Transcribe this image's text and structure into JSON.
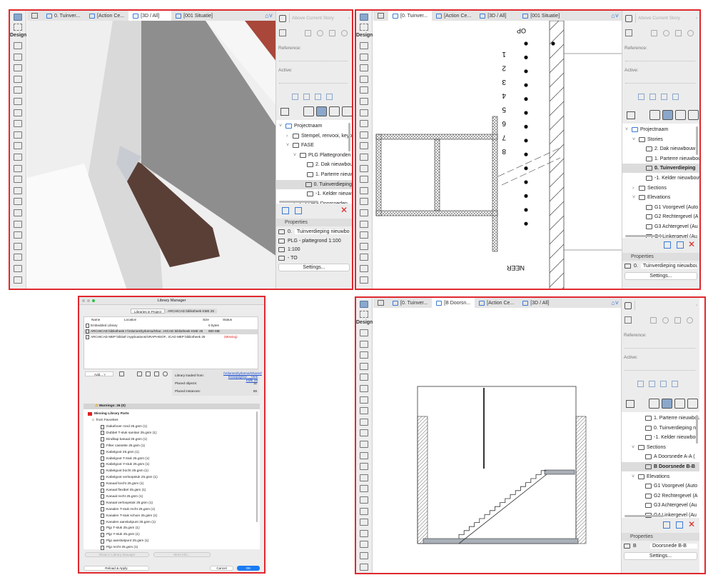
{
  "colors": {
    "accent": "#3a7bd5",
    "frame": "#e0282e",
    "missing": "#e02020",
    "ok_button": "#1a7cf5",
    "brick": "#a8473a",
    "stairs": "#5a3f36"
  },
  "toolbox": {
    "design_label": "Design"
  },
  "panel_3d": {
    "tabs": [
      {
        "label": "0. Tuinver...",
        "icon": "floor-plan-icon"
      },
      {
        "label": "[Action Ce...",
        "icon": "action-center-icon"
      },
      {
        "label": "[3D / All]",
        "icon": "3d-icon",
        "active": true
      },
      {
        "label": "[001 Situatie]",
        "icon": "layout-icon"
      }
    ],
    "story_label": "Above Current Story",
    "reference_label": "Reference:",
    "active_label": "Active:",
    "tree": [
      {
        "label": "Projectnaam",
        "level": 0,
        "arrow": "v"
      },
      {
        "label": "Stempel, renvooi, keyp",
        "level": 1,
        "arrow": ">"
      },
      {
        "label": "FASE",
        "level": 1,
        "arrow": "v"
      },
      {
        "label": "PLG Plattegronden",
        "level": 2,
        "arrow": "v"
      },
      {
        "label": "2. Dak nieuwbou",
        "level": 3
      },
      {
        "label": "1. Parterre nieuw",
        "level": 3
      },
      {
        "label": "0. Tuinverdieping",
        "level": 3,
        "selected": true
      },
      {
        "label": "-1. Kelder nieuwb",
        "level": 3
      },
      {
        "label": "DRS Doorsneden",
        "level": 2,
        "arrow": ">"
      }
    ],
    "properties_title": "Properties",
    "props": {
      "id": "0.",
      "name": "Tuinverdieping nieuwbouw",
      "view_set": "PLG - plattegrond 1:100",
      "scale": "1:100",
      "layer": "- TO"
    },
    "settings_label": "Settings..."
  },
  "panel_plan": {
    "tabs": [
      {
        "label": "[0. Tuinver...",
        "icon": "floor-plan-icon",
        "active": true
      },
      {
        "label": "[Action Ce...",
        "icon": "action-center-icon"
      },
      {
        "label": "[3D / All]",
        "icon": "3d-icon"
      },
      {
        "label": "[001 Situatie]",
        "icon": "layout-icon"
      }
    ],
    "story_label": "Above Current Story",
    "reference_label": "Reference:",
    "active_label": "Active:",
    "tree": [
      {
        "label": "Projectnaam",
        "level": 0,
        "arrow": "v"
      },
      {
        "label": "Stories",
        "level": 1,
        "arrow": "v"
      },
      {
        "label": "2. Dak nieuwbouw",
        "level": 2
      },
      {
        "label": "1. Parterre nieuwbouw",
        "level": 2
      },
      {
        "label": "0. Tuinverdieping",
        "level": 2,
        "selected": true,
        "bold": true
      },
      {
        "label": "-1. Kelder nieuwbouw",
        "level": 2
      },
      {
        "label": "Sections",
        "level": 1,
        "arrow": ">"
      },
      {
        "label": "Elevations",
        "level": 1,
        "arrow": "v"
      },
      {
        "label": "G1 Voorgevel (Auto",
        "level": 2
      },
      {
        "label": "G2 Rechtergevel (A",
        "level": 2
      },
      {
        "label": "G3 Achtergevel (Au",
        "level": 2
      },
      {
        "label": "G4 Linkergevel (Au",
        "level": 2
      }
    ],
    "properties_title": "Properties",
    "props": {
      "id": "0.",
      "name": "Tuinverdieping nieuwbouw"
    },
    "settings_label": "Settings...",
    "drawing": {
      "up_label": "OP",
      "down_label": "NEER",
      "step_numbers": [
        "1",
        "2",
        "3",
        "4",
        "5",
        "6",
        "7",
        "8"
      ]
    }
  },
  "panel_section": {
    "tabs": [
      {
        "label": "[0. Tuinver...",
        "icon": "floor-plan-icon"
      },
      {
        "label": "[B Doorsn...",
        "icon": "section-icon",
        "active": true
      },
      {
        "label": "[Action Ce...",
        "icon": "action-center-icon"
      },
      {
        "label": "[3D / All]",
        "icon": "3d-icon"
      }
    ],
    "reference_label": "Reference:",
    "active_label": "Active:",
    "tree": [
      {
        "label": "1. Parterre nieuwbouw",
        "level": 2
      },
      {
        "label": "0. Tuinverdieping n",
        "level": 2
      },
      {
        "label": "-1. Kelder nieuwbou",
        "level": 2
      },
      {
        "label": "Sections",
        "level": 1,
        "arrow": "v"
      },
      {
        "label": "A Doorsnede A-A (",
        "level": 2
      },
      {
        "label": "B Doorsnede B-B",
        "level": 2,
        "selected": true,
        "bold": true
      },
      {
        "label": "Elevations",
        "level": 1,
        "arrow": "v"
      },
      {
        "label": "G1 Voorgevel (Auto",
        "level": 2
      },
      {
        "label": "G2 Rechtergevel (A",
        "level": 2
      },
      {
        "label": "G3 Achtergevel (Au",
        "level": 2
      },
      {
        "label": "G4 Linkergevel (Au",
        "level": 2
      }
    ],
    "properties_title": "Properties",
    "props": {
      "id": "B",
      "name": "Doorsnede B-B"
    },
    "settings_label": "Settings..."
  },
  "library_manager": {
    "title": "Library Manager",
    "tabs": [
      "Libraries in Project",
      "ARCHICAD bibliotheek KME 25"
    ],
    "columns": [
      "Name",
      "Location",
      "Size",
      "Status"
    ],
    "rows": [
      {
        "name": "Embedded Library",
        "location": "",
        "size": "0 bytes",
        "status": ""
      },
      {
        "name": "ARCHICAD bibliotheek KM...",
        "location": "/Volumes/tyrkema/Shar...HICAD bibliotheek KME 25",
        "size": "980 MB",
        "status": "",
        "selected": true
      },
      {
        "name": "ARCHICAD MEP bibliothee...",
        "location": "/Applications/GRAPHISOF...ICAD MEP bibliotheek 25",
        "size": "",
        "status": "(Missing)"
      }
    ],
    "add_label": "Add...",
    "loaded_from_label": "Library loaded from:",
    "loaded_from_path": "/Volumes/tyrkema/Shared/ bouwpagina/..._teek KME 25",
    "placed_objects_label": "Placed objects:",
    "placed_objects": "11",
    "placed_instances_label": "Placed instances:",
    "placed_instances": "59",
    "warnings_label": "Warnings: 26 (0)",
    "missing_label": "Missing Library Parts",
    "favorites_label": "from Favorites",
    "items": [
      "Dakafvoer rond 25.gsm (1)",
      "Dubbel T-stuk sanitair 25.gsm (1)",
      "Eindkap kanaal 25.gsm (1)",
      "Filter cassette 25.gsm (1)",
      "Kabelgoot 25.gsm (1)",
      "Kabelgoot T-stuk 25.gsm (1)",
      "Kabelgoot Y-stuk 25.gsm (1)",
      "Kabelgoot bocht 25.gsm (1)",
      "Kabelgoot verloopstuk 25.gsm (1)",
      "Kanaal bocht 25.gsm (1)",
      "Kanaal flexibel 25.gsm (1)",
      "Kanaal recht 25.gsm (1)",
      "Kanaal verloopstuk 25.gsm (1)",
      "Kanalen T-stuk recht 25.gsm (1)",
      "Kanalen T-stuk schuin 25.gsm (1)",
      "Kanalen aansluitpunt 25.gsm (1)",
      "Pijp T-stuk 25.gsm (1)",
      "Pijp Y-stuk 25.gsm (1)",
      "Pijp aansluitpunt 25.gsm (1)",
      "Pijp recht 25.gsm (1)"
    ],
    "show_in_label": "Show in Library Manager",
    "more_info_label": "More Info...",
    "reload_label": "Reload & Apply",
    "cancel_label": "Cancel",
    "ok_label": "OK"
  }
}
